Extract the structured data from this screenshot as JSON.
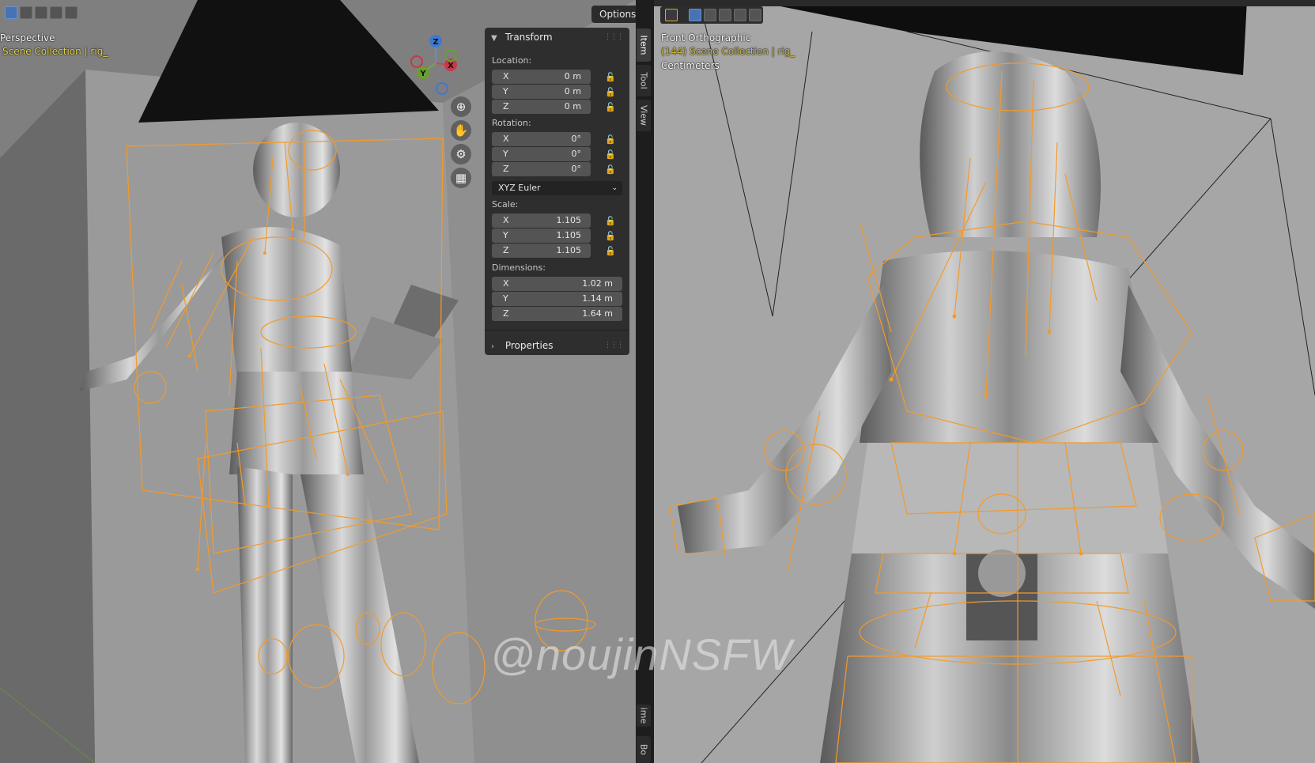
{
  "left_view": {
    "view_name": "Perspective",
    "collection": "Scene Collection | rig_",
    "options_label": "Options"
  },
  "right_view": {
    "view_name": "Front Orthographic",
    "collection": "(144) Scene Collection | rig_",
    "units": "Centimeters"
  },
  "gizmo": {
    "z": "Z",
    "y": "Y",
    "x": "X"
  },
  "transform": {
    "header": "Transform",
    "location_label": "Location:",
    "location": [
      {
        "axis": "X",
        "value": "0 m"
      },
      {
        "axis": "Y",
        "value": "0 m"
      },
      {
        "axis": "Z",
        "value": "0 m"
      }
    ],
    "rotation_label": "Rotation:",
    "rotation": [
      {
        "axis": "X",
        "value": "0°"
      },
      {
        "axis": "Y",
        "value": "0°"
      },
      {
        "axis": "Z",
        "value": "0°"
      }
    ],
    "rotation_mode": "XYZ Euler",
    "scale_label": "Scale:",
    "scale": [
      {
        "axis": "X",
        "value": "1.105"
      },
      {
        "axis": "Y",
        "value": "1.105"
      },
      {
        "axis": "Z",
        "value": "1.105"
      }
    ],
    "dimensions_label": "Dimensions:",
    "dimensions": [
      {
        "axis": "X",
        "value": "1.02 m"
      },
      {
        "axis": "Y",
        "value": "1.14 m"
      },
      {
        "axis": "Z",
        "value": "1.64 m"
      }
    ]
  },
  "properties": {
    "header": "Properties"
  },
  "tabs": [
    "Item",
    "Tool",
    "View",
    "ime",
    "Bo"
  ],
  "watermark": "@noujinNSFW",
  "colors": {
    "rig": "#f39a2a",
    "panel": "#2e2e2e",
    "field": "#545454",
    "selection": "#4772b3"
  }
}
